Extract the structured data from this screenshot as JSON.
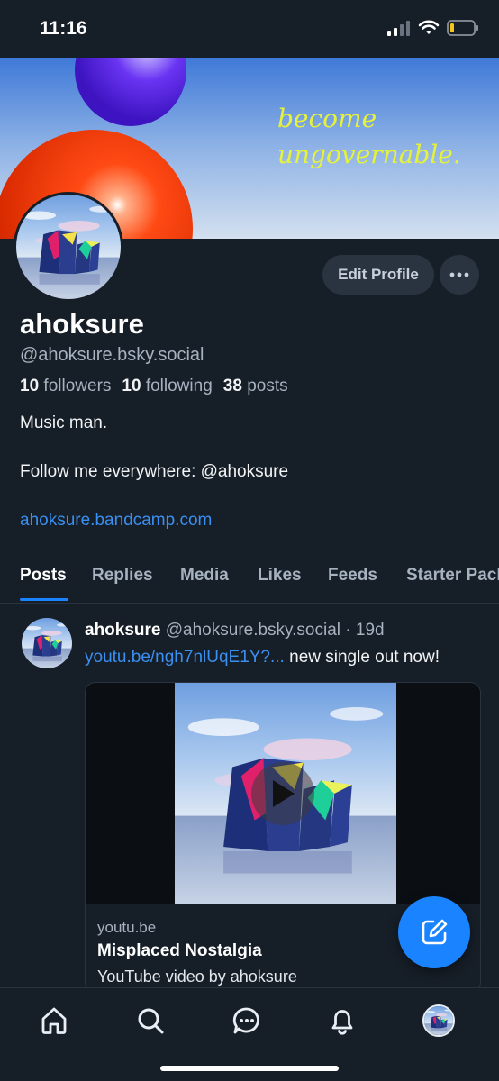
{
  "status_bar": {
    "time": "11:16"
  },
  "banner": {
    "tagline_line1": "become",
    "tagline_line2": "ungovernable."
  },
  "profile": {
    "edit_label": "Edit Profile",
    "more_label": "•••",
    "display_name": "ahoksure",
    "handle": "@ahoksure.bsky.social",
    "followers_count": "10",
    "followers_label": "followers",
    "following_count": "10",
    "following_label": "following",
    "posts_count": "38",
    "posts_label": "posts",
    "bio_line1": "Music man.",
    "bio_line2": "Follow me everywhere: @ahoksure",
    "link": "ahoksure.bandcamp.com"
  },
  "tabs": [
    "Posts",
    "Replies",
    "Media",
    "Likes",
    "Feeds",
    "Starter Packs"
  ],
  "active_tab": "Posts",
  "post": {
    "author": "ahoksure",
    "handle": "@ahoksure.bsky.social",
    "separator": "·",
    "age": "19d",
    "link_text": "youtu.be/ngh7nlUqE1Y?...",
    "text": " new single out now!",
    "embed": {
      "domain": "youtu.be",
      "title": "Misplaced Nostalgia",
      "description": "YouTube video by ahoksure"
    }
  },
  "icons": {
    "compose": "compose-icon",
    "nav": [
      "home-icon",
      "search-icon",
      "chat-icon",
      "bell-icon",
      "profile-avatar"
    ]
  },
  "colors": {
    "background": "#161e27",
    "accent": "#1a83ff",
    "link": "#3b8ff0",
    "tagline": "#e6f23a"
  }
}
